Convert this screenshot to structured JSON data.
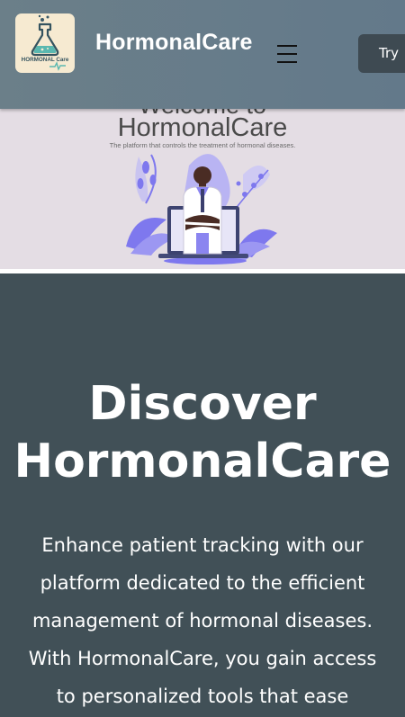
{
  "header": {
    "logo_text": "HORMONAL Care",
    "brand": "HormonalCare",
    "menu_icon": "hamburger-menu-icon",
    "try_label": "Try"
  },
  "hero": {
    "welcome": "Welcome to",
    "title": "HormonalCare",
    "subtitle": "The platform that controls the treatment of hormonal diseases."
  },
  "discover": {
    "title_line1": "Discover",
    "title_line2": "HormonalCare",
    "text_lines": [
      "Enhance patient tracking with our",
      "platform dedicated to the efficient",
      "management of hormonal diseases.",
      "With HormonalCare, you gain access",
      "to personalized tools that ease"
    ]
  },
  "colors": {
    "header": "#667c88",
    "discover_bg": "#415057",
    "hero_bg": "#e4dde4",
    "accent": "#8b85f0"
  }
}
